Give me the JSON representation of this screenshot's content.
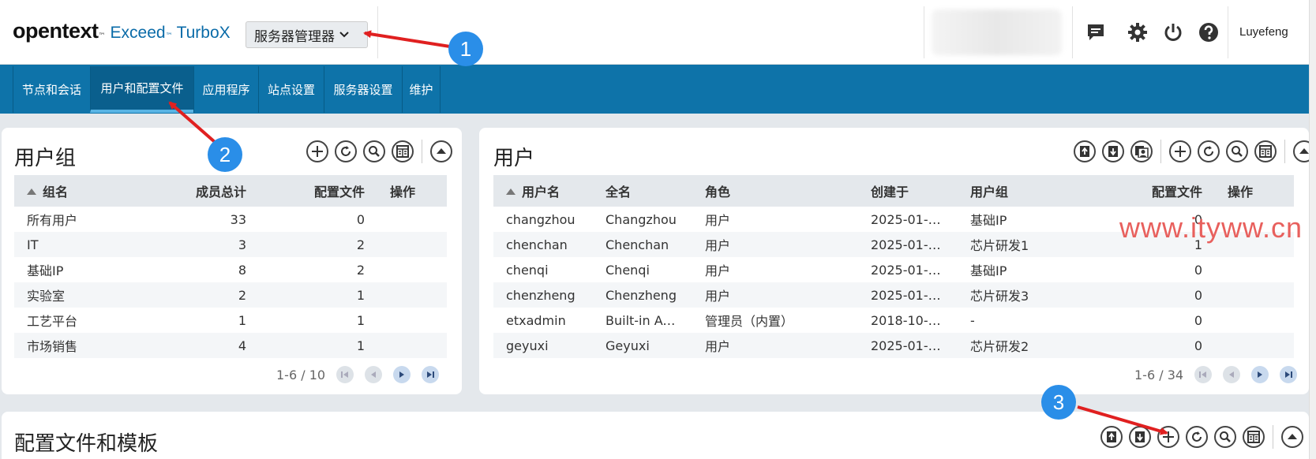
{
  "header": {
    "brand": "opentext",
    "brand_tm": "™",
    "product": "Exceed",
    "product_tm": "™",
    "product2": "TurboX",
    "server_select": "服务器管理器",
    "username": "Luyefeng"
  },
  "nav": {
    "tabs": [
      "节点和会话",
      "用户和配置文件",
      "应用程序",
      "站点设置",
      "服务器设置",
      "维护"
    ]
  },
  "groups": {
    "title": "用户组",
    "columns": [
      "组名",
      "成员总计",
      "配置文件",
      "操作"
    ],
    "rows": [
      [
        "所有用户",
        "33",
        "0"
      ],
      [
        "IT",
        "3",
        "2"
      ],
      [
        "基础IP",
        "8",
        "2"
      ],
      [
        "实验室",
        "2",
        "1"
      ],
      [
        "工艺平台",
        "1",
        "1"
      ],
      [
        "市场销售",
        "4",
        "1"
      ]
    ],
    "pager": "1-6 / 10"
  },
  "users": {
    "title": "用户",
    "columns": [
      "用户名",
      "全名",
      "角色",
      "创建于",
      "用户组",
      "配置文件",
      "操作"
    ],
    "rows": [
      [
        "changzhou",
        "Changzhou",
        "用户",
        "2025-01-09…",
        "基础IP",
        "0"
      ],
      [
        "chenchan",
        "Chenchan",
        "用户",
        "2025-01-15…",
        "芯片研发1",
        "1"
      ],
      [
        "chenqi",
        "Chenqi",
        "用户",
        "2025-01-08…",
        "基础IP",
        "0"
      ],
      [
        "chenzheng",
        "Chenzheng",
        "用户",
        "2025-01-13…",
        "芯片研发3",
        "0"
      ],
      [
        "etxadmin",
        "Built-in Ad…",
        "管理员（内置）",
        "2018-10-31…",
        "-",
        "0"
      ],
      [
        "geyuxi",
        "Geyuxi",
        "用户",
        "2025-01-20…",
        "芯片研发2",
        "0"
      ]
    ],
    "pager": "1-6 / 34"
  },
  "profiles": {
    "title": "配置文件和模板"
  },
  "watermark": "www.ityww.cn",
  "annotations": [
    "1",
    "2",
    "3"
  ],
  "colors": {
    "nav_bg": "#0e73a9",
    "annotation_badge": "#2a8ee8",
    "annotation_arrow": "#e02020",
    "watermark": "#e8605d"
  }
}
